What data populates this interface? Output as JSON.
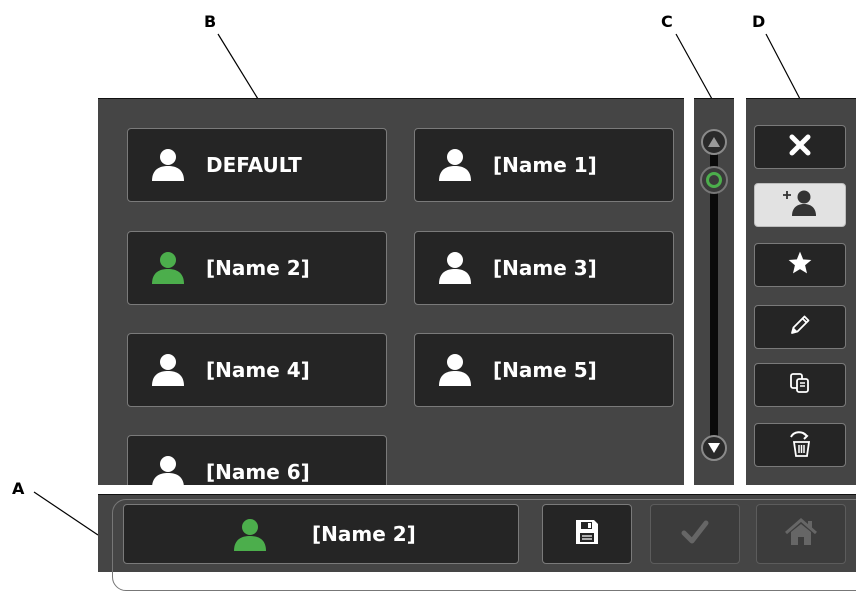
{
  "callouts": {
    "a": "A",
    "b": "B",
    "c": "C",
    "d": "D"
  },
  "profiles": [
    {
      "label": "DEFAULT",
      "icon": "user-icon",
      "selected": false
    },
    {
      "label": "[Name 1]",
      "icon": "user-icon",
      "selected": false
    },
    {
      "label": "[Name 2]",
      "icon": "user-icon",
      "selected": true
    },
    {
      "label": "[Name 3]",
      "icon": "user-icon",
      "selected": false
    },
    {
      "label": "[Name 4]",
      "icon": "user-icon",
      "selected": false
    },
    {
      "label": "[Name 5]",
      "icon": "user-icon",
      "selected": false
    },
    {
      "label": "[Name 6]",
      "icon": "user-icon",
      "selected": false
    }
  ],
  "scrollbar": {
    "up_icon": "arrow-up-icon",
    "down_icon": "arrow-down-icon",
    "thumb_icon": "scroll-thumb-icon"
  },
  "toolbar": [
    {
      "name": "close",
      "icon": "close-icon"
    },
    {
      "name": "add-user",
      "icon": "add-user-icon",
      "active": true
    },
    {
      "name": "favorite",
      "icon": "star-icon"
    },
    {
      "name": "edit",
      "icon": "pencil-icon"
    },
    {
      "name": "copy",
      "icon": "copy-icon"
    },
    {
      "name": "delete",
      "icon": "trash-icon"
    }
  ],
  "bottom_bar": {
    "current_profile": "[Name 2]",
    "save_icon": "floppy-disk-icon",
    "confirm_icon": "checkmark-icon",
    "home_icon": "home-icon"
  },
  "colors": {
    "panel_bg": "#454545",
    "button_bg": "#252525",
    "selected_user": "#4cae4c",
    "user_icon": "#ffffff",
    "active_tool_bg": "#e2e2e2"
  }
}
